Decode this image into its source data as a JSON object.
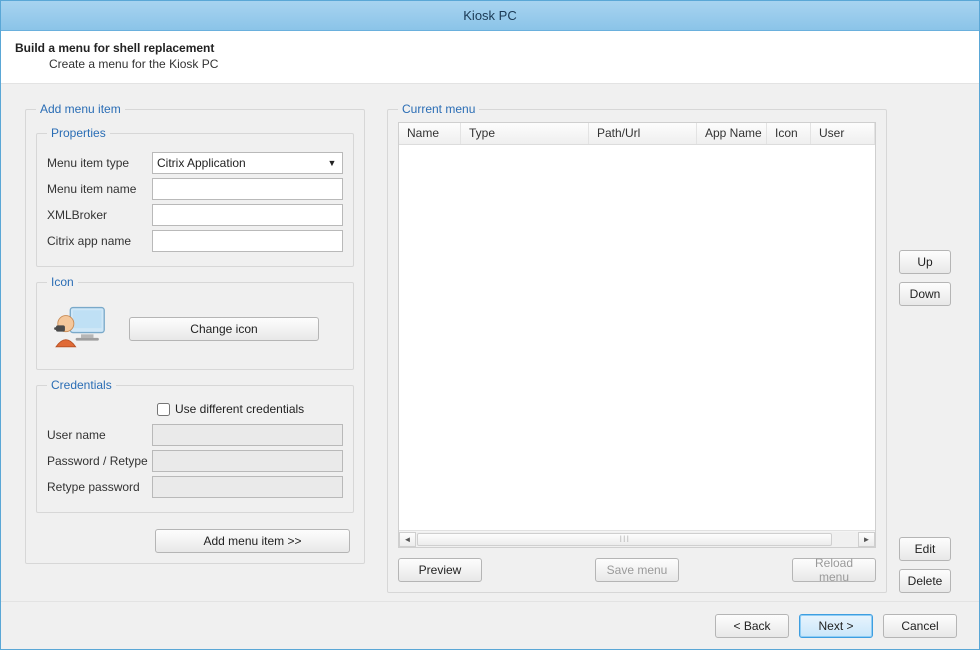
{
  "window": {
    "title": "Kiosk PC"
  },
  "header": {
    "title": "Build a menu for shell replacement",
    "subtitle": "Create a menu for the Kiosk PC"
  },
  "left": {
    "group_title": "Add menu item",
    "properties": {
      "legend": "Properties",
      "menu_item_type_label": "Menu item type",
      "menu_item_type_value": "Citrix Application",
      "menu_item_name_label": "Menu item name",
      "menu_item_name_value": "",
      "xml_broker_label": "XMLBroker",
      "xml_broker_value": "",
      "citrix_app_name_label": "Citrix app name",
      "citrix_app_name_value": ""
    },
    "icon": {
      "legend": "Icon",
      "change_button": "Change icon"
    },
    "credentials": {
      "legend": "Credentials",
      "use_diff_label": "Use different credentials",
      "use_diff_checked": false,
      "username_label": "User name",
      "username_value": "",
      "password_label": "Password / Retype",
      "password_value": "",
      "retype_label": "Retype password",
      "retype_value": ""
    },
    "add_button": "Add menu item >>"
  },
  "right": {
    "legend": "Current menu",
    "columns": [
      "Name",
      "Type",
      "Path/Url",
      "App Name",
      "Icon",
      "User"
    ],
    "rows": [],
    "buttons": {
      "preview": "Preview",
      "save": "Save menu",
      "reload": "Reload menu",
      "up": "Up",
      "down": "Down",
      "edit": "Edit",
      "delete": "Delete"
    }
  },
  "footer": {
    "back": "< Back",
    "next": "Next >",
    "cancel": "Cancel"
  }
}
